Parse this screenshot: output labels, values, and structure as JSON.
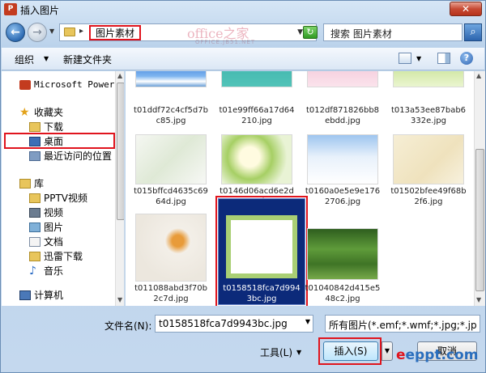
{
  "window": {
    "title": "插入图片",
    "close_glyph": "✕"
  },
  "address": {
    "crumb": "图片素材",
    "separator": "▸"
  },
  "search": {
    "placeholder": "搜索 图片素材"
  },
  "watermark": {
    "line1": "office之家",
    "line2": "OFFICE.JB51.NET"
  },
  "toolbar": {
    "organize": "组织",
    "new_folder": "新建文件夹"
  },
  "nav": {
    "items": [
      {
        "label": "Microsoft PowerPo",
        "icon": "powerpoint-icon"
      },
      {
        "label": "收藏夹",
        "icon": "star-icon"
      },
      {
        "label": "下载",
        "icon": "download-folder-icon"
      },
      {
        "label": "桌面",
        "icon": "desktop-icon"
      },
      {
        "label": "最近访问的位置",
        "icon": "recent-places-icon"
      },
      {
        "label": "库",
        "icon": "library-icon"
      },
      {
        "label": "PPTV视频",
        "icon": "folder-icon"
      },
      {
        "label": "视频",
        "icon": "video-library-icon"
      },
      {
        "label": "图片",
        "icon": "picture-library-icon"
      },
      {
        "label": "文档",
        "icon": "document-library-icon"
      },
      {
        "label": "迅雷下载",
        "icon": "folder-icon"
      },
      {
        "label": "音乐",
        "icon": "music-library-icon"
      },
      {
        "label": "计算机",
        "icon": "computer-icon"
      }
    ]
  },
  "files": [
    {
      "name": "t01ddf72c4cf5d7bc85.jpg"
    },
    {
      "name": "t01e99ff66a17d64210.jpg"
    },
    {
      "name": "t012df871826bb8ebdd.jpg"
    },
    {
      "name": "t013a53ee87bab6332e.jpg"
    },
    {
      "name": "t015bffcd4635c6964d.jpg"
    },
    {
      "name": "t0146d06acd6e2d0461.jpg"
    },
    {
      "name": "t0160a0e5e9e1762706.jpg"
    },
    {
      "name": "t01502bfee49f68b2f6.jpg"
    },
    {
      "name": "t011088abd3f70b2c7d.jpg"
    },
    {
      "name": "t0158518fca7d9943bc.jpg"
    },
    {
      "name": "t01040842d415e548c2.jpg"
    }
  ],
  "bottom": {
    "filename_label": "文件名(N):",
    "filename_value": "t0158518fca7d9943bc.jpg",
    "filetype_value": "所有图片(*.emf;*.wmf;*.jpg;*.jp",
    "tools_label": "工具(L)",
    "insert_label": "插入(S)",
    "cancel_label": "取消",
    "brand_e": "e",
    "brand_rest": "eppt.com"
  }
}
